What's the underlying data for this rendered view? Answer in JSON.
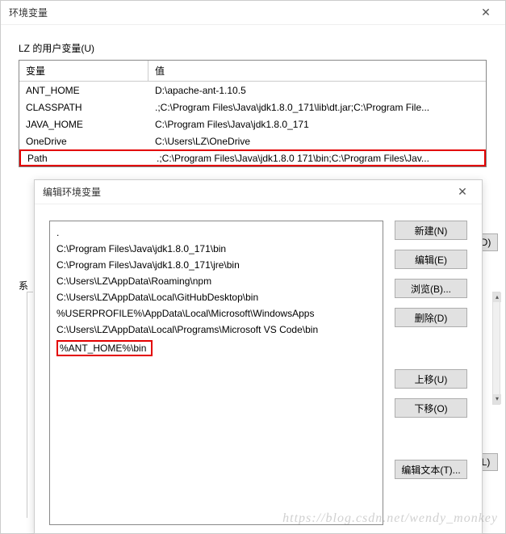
{
  "parent": {
    "title": "环境变量",
    "user_vars_label": "LZ 的用户变量(U)",
    "cols": {
      "name": "变量",
      "value": "值"
    },
    "rows": [
      {
        "name": "ANT_HOME",
        "value": "D:\\apache-ant-1.10.5"
      },
      {
        "name": "CLASSPATH",
        "value": ".;C:\\Program Files\\Java\\jdk1.8.0_171\\lib\\dt.jar;C:\\Program File..."
      },
      {
        "name": "JAVA_HOME",
        "value": "C:\\Program Files\\Java\\jdk1.8.0_171"
      },
      {
        "name": "OneDrive",
        "value": "C:\\Users\\LZ\\OneDrive"
      },
      {
        "name": "Path",
        "value": ".;C:\\Program Files\\Java\\jdk1.8.0 171\\bin;C:\\Program Files\\Jav...",
        "highlight": true
      }
    ],
    "sys_label": "系",
    "hidden_buttons": {
      "d": "D)",
      "l": "L)"
    }
  },
  "child": {
    "title": "编辑环境变量",
    "items": [
      ".",
      "C:\\Program Files\\Java\\jdk1.8.0_171\\bin",
      "C:\\Program Files\\Java\\jdk1.8.0_171\\jre\\bin",
      "C:\\Users\\LZ\\AppData\\Roaming\\npm",
      "C:\\Users\\LZ\\AppData\\Local\\GitHubDesktop\\bin",
      "%USERPROFILE%\\AppData\\Local\\Microsoft\\WindowsApps",
      "C:\\Users\\LZ\\AppData\\Local\\Programs\\Microsoft VS Code\\bin",
      "%ANT_HOME%\\bin"
    ],
    "highlight_index": 7,
    "buttons": {
      "new": "新建(N)",
      "edit": "编辑(E)",
      "browse": "浏览(B)...",
      "delete": "删除(D)",
      "up": "上移(U)",
      "down": "下移(O)",
      "edit_text": "编辑文本(T)..."
    }
  },
  "watermark": "https://blog.csdn.net/wendy_monkey"
}
